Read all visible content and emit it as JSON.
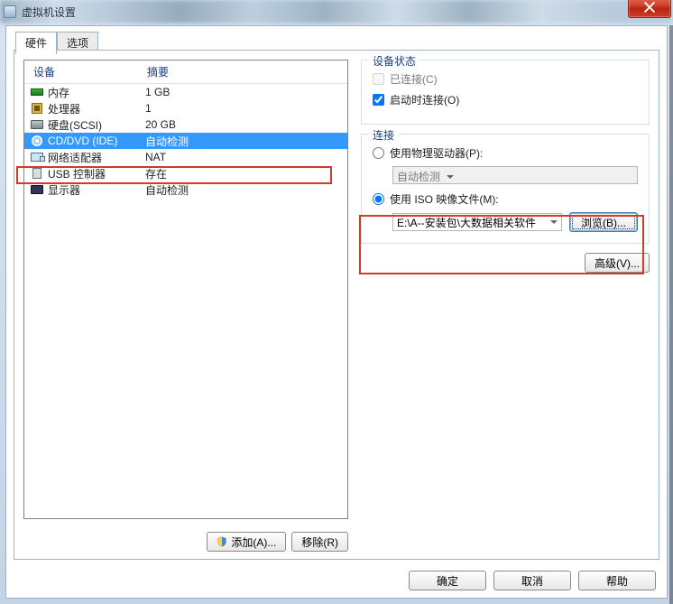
{
  "window": {
    "title": "虚拟机设置"
  },
  "tabs": {
    "hardware": "硬件",
    "options": "选项"
  },
  "device_list": {
    "header_device": "设备",
    "header_summary": "摘要",
    "rows": [
      {
        "label": "内存",
        "summary": "1 GB"
      },
      {
        "label": "处理器",
        "summary": "1"
      },
      {
        "label": "硬盘(SCSI)",
        "summary": "20 GB"
      },
      {
        "label": "CD/DVD (IDE)",
        "summary": "自动检测"
      },
      {
        "label": "网络适配器",
        "summary": "NAT"
      },
      {
        "label": "USB 控制器",
        "summary": "存在"
      },
      {
        "label": "显示器",
        "summary": "自动检测"
      }
    ],
    "selected_index": 3,
    "add_btn": "添加(A)...",
    "remove_btn": "移除(R)"
  },
  "status_group": {
    "title": "设备状态",
    "connected_label": "已连接(C)",
    "connected_checked": false,
    "connect_on_label": "启动时连接(O)",
    "connect_on_checked": true
  },
  "connection_group": {
    "title": "连接",
    "use_physical_label": "使用物理驱动器(P):",
    "use_physical_selected": false,
    "physical_combo_value": "自动检测",
    "use_iso_label": "使用 ISO 映像文件(M):",
    "use_iso_selected": true,
    "iso_path_value": "E:\\A--安装包\\大数据相关软件",
    "browse_btn": "浏览(B)...",
    "advanced_btn": "高级(V)..."
  },
  "dialog_buttons": {
    "ok": "确定",
    "cancel": "取消",
    "help": "帮助"
  }
}
